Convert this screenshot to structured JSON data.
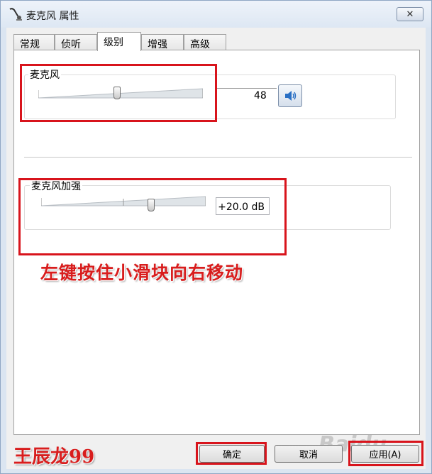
{
  "window": {
    "title": "麦克风 属性",
    "close_label": "✕"
  },
  "tabs": [
    {
      "label": "常规",
      "active": false
    },
    {
      "label": "侦听",
      "active": false
    },
    {
      "label": "级别",
      "active": true
    },
    {
      "label": "增强",
      "active": false
    },
    {
      "label": "高级",
      "active": false
    }
  ],
  "levels": {
    "microphone": {
      "label": "麦克风",
      "value": "48",
      "level": 48
    },
    "boost": {
      "label": "麦克风加强",
      "value": "+20.0 dB",
      "level_fraction": 0.667
    }
  },
  "annotation": {
    "instruction": "左键按住小滑块向右移动",
    "author": "王辰龙99"
  },
  "buttons": {
    "ok": "确定",
    "cancel": "取消",
    "apply": "应用(A)"
  },
  "watermark": "Baidu",
  "colors": {
    "highlight_red": "#d8141c",
    "window_frame": "#dbe5f1"
  }
}
